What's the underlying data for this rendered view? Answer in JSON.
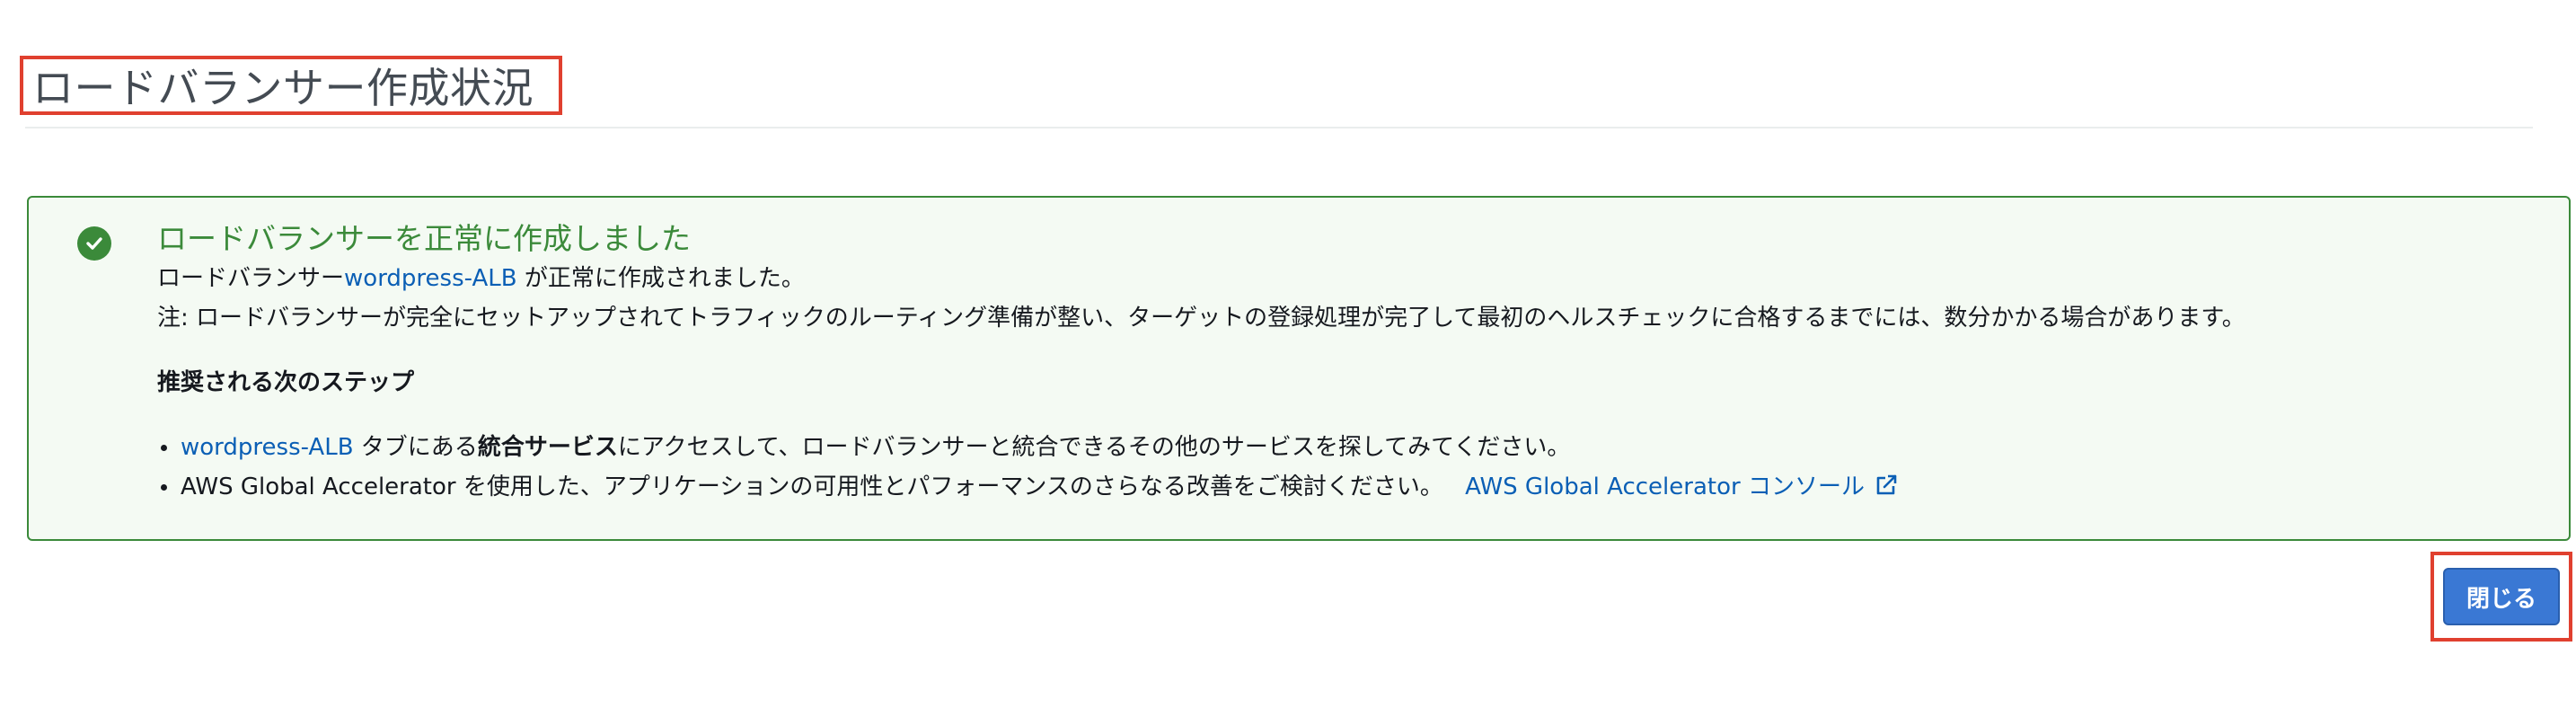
{
  "page": {
    "title": "ロードバランサー作成状況"
  },
  "success": {
    "heading": "ロードバランサーを正常に作成しました",
    "created_prefix": "ロードバランサー",
    "lb_name": "wordpress-ALB",
    "created_suffix": " が正常に作成されました。",
    "note": "注: ロードバランサーが完全にセットアップされてトラフィックのルーティング準備が整い、ターゲットの登録処理が完了して最初のヘルスチェックに合格するまでには、数分かかる場合があります。",
    "status_color": "#3b8a3a"
  },
  "next_steps": {
    "heading": "推奨される次のステップ",
    "step1": {
      "link": "wordpress-ALB",
      "text_before_bold": " タブにある",
      "bold": "統合サービス",
      "text_after_bold": "にアクセスして、ロードバランサーと統合できるその他のサービスを探してみてください。"
    },
    "step2": {
      "text": "AWS Global Accelerator を使用した、アプリケーションの可用性とパフォーマンスのさらなる改善をご検討ください。",
      "link": "AWS Global Accelerator コンソール"
    }
  },
  "actions": {
    "close_label": "閉じる",
    "accent": "#3a78d4"
  }
}
